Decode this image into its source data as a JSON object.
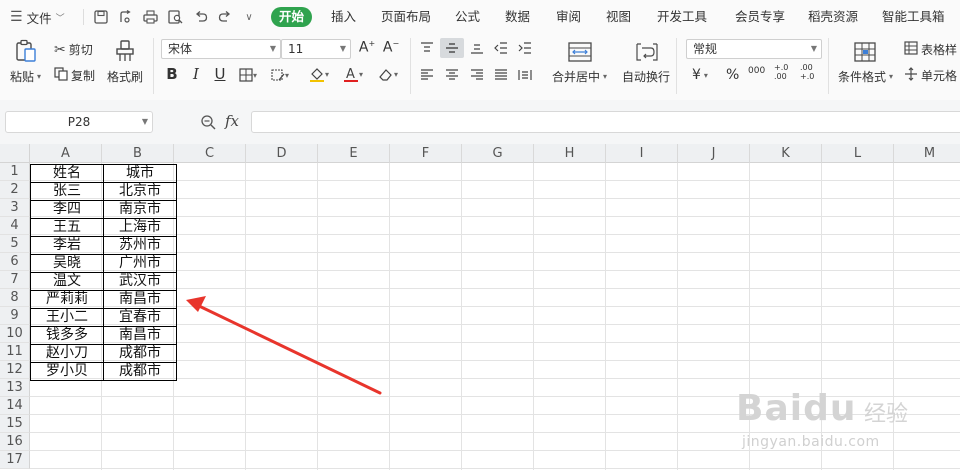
{
  "menu": {
    "file_label": "文件",
    "tabs": [
      {
        "label": "开始",
        "active": true
      },
      {
        "label": "插入"
      },
      {
        "label": "页面布局"
      },
      {
        "label": "公式"
      },
      {
        "label": "数据"
      },
      {
        "label": "审阅"
      },
      {
        "label": "视图"
      },
      {
        "label": "开发工具"
      },
      {
        "label": "会员专享"
      },
      {
        "label": "稻壳资源"
      },
      {
        "label": "智能工具箱"
      }
    ]
  },
  "ribbon": {
    "paste_label": "粘贴",
    "cut_label": "剪切",
    "copy_label": "复制",
    "format_painter_label": "格式刷",
    "font_name": "宋体",
    "font_size": "11",
    "merge_center_label": "合并居中",
    "wrap_text_label": "自动换行",
    "number_format": "常规",
    "currency_symbol": "¥",
    "percent_symbol": "%",
    "thousands_symbol": "000",
    "increase_decimal": "+.0 .00",
    "decrease_decimal": ".00 +.0",
    "conditional_format_label": "条件格式",
    "table_style_label": "表格样",
    "cell_label": "单元格",
    "bold": "B",
    "italic": "I",
    "underline": "U"
  },
  "formula_bar": {
    "name_box": "P28",
    "fx_label": "fx",
    "content": ""
  },
  "sheet": {
    "columns": [
      "A",
      "B",
      "C",
      "D",
      "E",
      "F",
      "G",
      "H",
      "I",
      "J",
      "K",
      "L",
      "M"
    ],
    "rows": [
      "1",
      "2",
      "3",
      "4",
      "5",
      "6",
      "7",
      "8",
      "9",
      "10",
      "11",
      "12",
      "13",
      "14",
      "15",
      "16",
      "17"
    ],
    "data": [
      [
        "姓名",
        "城市"
      ],
      [
        "张三",
        "北京市"
      ],
      [
        "李四",
        "南京市"
      ],
      [
        "王五",
        "上海市"
      ],
      [
        "李岩",
        "苏州市"
      ],
      [
        "吴晓",
        "广州市"
      ],
      [
        "温文",
        "武汉市"
      ],
      [
        "严莉莉",
        "南昌市"
      ],
      [
        "王小二",
        "宜春市"
      ],
      [
        "钱多多",
        "南昌市"
      ],
      [
        "赵小刀",
        "成都市"
      ],
      [
        "罗小贝",
        "成都市"
      ]
    ]
  },
  "annotation": {
    "arrow_color": "#e8352c"
  },
  "watermark": {
    "logo": "Baidu",
    "cn": "经验",
    "url": "jingyan.baidu.com"
  },
  "colors": {
    "active_tab": "#2fa34e",
    "header_bg": "#eef0f2"
  }
}
